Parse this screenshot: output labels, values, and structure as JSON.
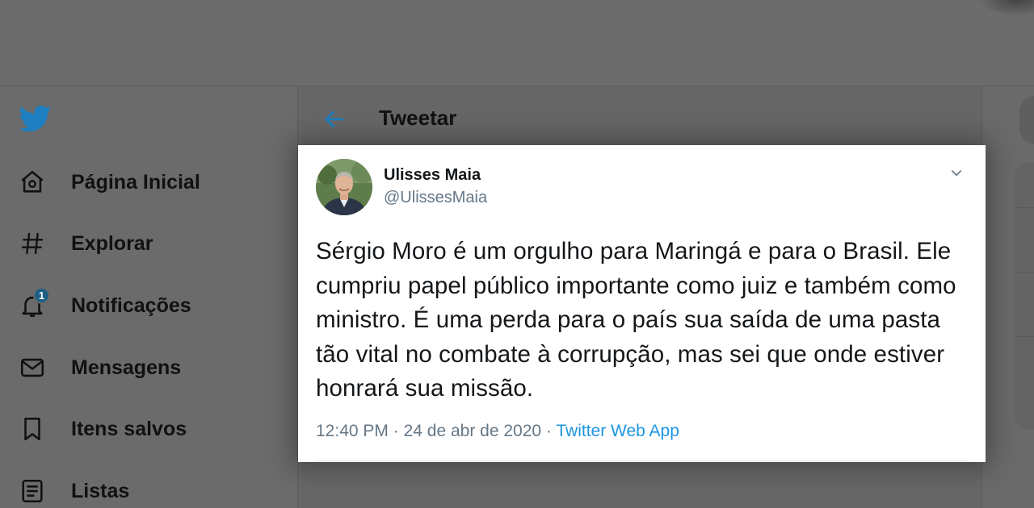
{
  "colors": {
    "twitter_blue": "#1d7fc0",
    "link_blue": "#1b95e0",
    "overlay_gray": "#6a6a6a",
    "text_dark": "#14171a",
    "text_muted": "#657786"
  },
  "sidebar": {
    "logo_icon": "twitter-bird-icon",
    "items": [
      {
        "label": "Página Inicial",
        "icon": "home-icon"
      },
      {
        "label": "Explorar",
        "icon": "hashtag-icon"
      },
      {
        "label": "Notificações",
        "icon": "bell-icon",
        "badge": "1"
      },
      {
        "label": "Mensagens",
        "icon": "envelope-icon"
      },
      {
        "label": "Itens salvos",
        "icon": "bookmark-icon"
      },
      {
        "label": "Listas",
        "icon": "list-icon"
      }
    ]
  },
  "main": {
    "header_title": "Tweetar",
    "back_icon": "arrow-left-icon"
  },
  "tweet": {
    "author_name": "Ulisses Maia",
    "author_handle": "@UlissesMaia",
    "text": "Sérgio Moro é um orgulho para Maringá e para o Brasil. Ele cumpriu papel público importante como juiz e também como ministro. É uma perda para o país sua saída de uma pasta tão vital no combate à corrupção, mas sei que onde estiver honrará sua missão.",
    "time": "12:40 PM",
    "separator": "·",
    "date": "24 de abr de 2020",
    "source": "Twitter Web App"
  }
}
